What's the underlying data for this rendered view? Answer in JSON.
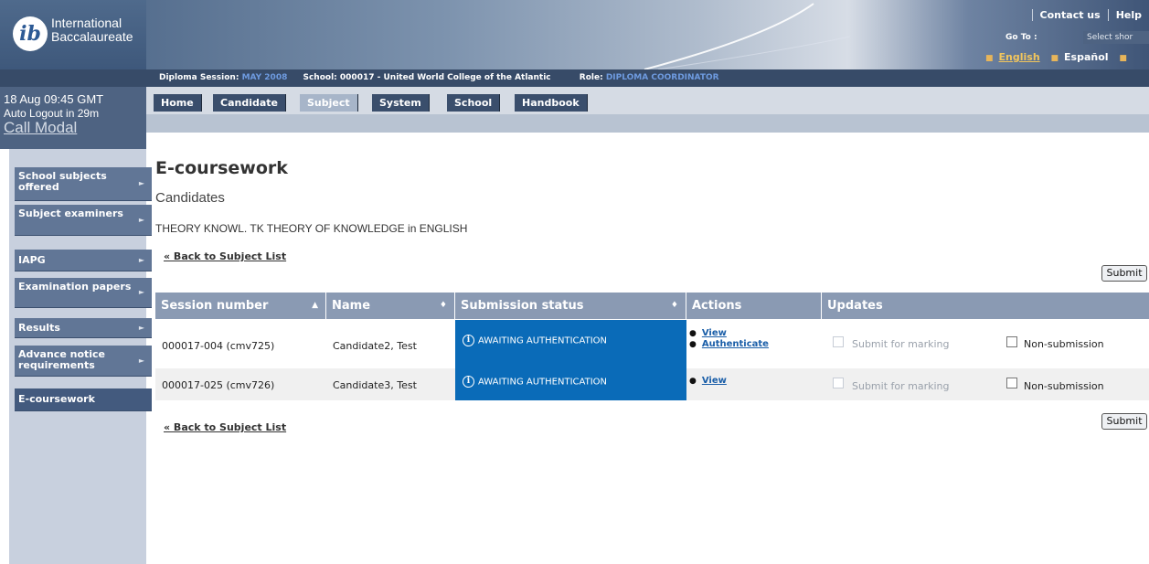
{
  "brand": {
    "line1": "International",
    "line2": "Baccalaureate",
    "mark": "ib"
  },
  "toplinks": {
    "contact": "Contact us",
    "help": "Help"
  },
  "goto": {
    "label": "Go To :",
    "select_value": "Select shor"
  },
  "languages": {
    "english": "English",
    "spanish": "Español"
  },
  "session": {
    "session_label": "Diploma Session:",
    "session_value": "MAY 2008",
    "school_label": "School:",
    "school_value": "000017 - United World College of the Atlantic",
    "role_label": "Role:",
    "role_value": "DIPLOMA COORDINATOR"
  },
  "clock": {
    "time": "18 Aug 09:45 GMT",
    "logout": "Auto Logout in 29m",
    "call_modal": "Call Modal"
  },
  "tabs": [
    "Home",
    "Candidate",
    "Subject",
    "System",
    "School",
    "Handbook"
  ],
  "active_tab": "Subject",
  "sidebar": {
    "items": [
      {
        "label": "School subjects offered"
      },
      {
        "label": "Subject examiners"
      },
      {
        "label": "IAPG"
      },
      {
        "label": "Examination papers"
      },
      {
        "label": "Results"
      },
      {
        "label": "Advance notice requirements"
      },
      {
        "label": "E-coursework"
      }
    ],
    "arrow": "►"
  },
  "main": {
    "title": "E-coursework",
    "subtitle": "Candidates",
    "subject": "THEORY KNOWL. TK THEORY OF KNOWLEDGE in ENGLISH",
    "back_link": "« Back to Subject List",
    "submit": "Submit"
  },
  "table": {
    "headers": {
      "session": "Session number",
      "name": "Name",
      "status": "Submission status",
      "actions": "Actions",
      "updates": "Updates"
    },
    "sort_up": "▲",
    "sort_both": "♦",
    "rows": [
      {
        "session": "000017-004 (cmv725)",
        "name": "Candidate2, Test",
        "status": "AWAITING AUTHENTICATION",
        "action1": "View",
        "action2": "Authenticate",
        "submit_marking": "Submit for marking",
        "non_submission": "Non-submission"
      },
      {
        "session": "000017-025 (cmv726)",
        "name": "Candidate3, Test",
        "status": "AWAITING AUTHENTICATION",
        "action1": "View",
        "submit_marking": "Submit for marking",
        "non_submission": "Non-submission"
      }
    ]
  },
  "colors": {
    "nav_dark": "#374b68",
    "tab_dark": "#3a4e6c",
    "header_grey": "#8a9ab3",
    "status_blue": "#0a6bb8",
    "highlight_blue": "#6e9be0"
  }
}
